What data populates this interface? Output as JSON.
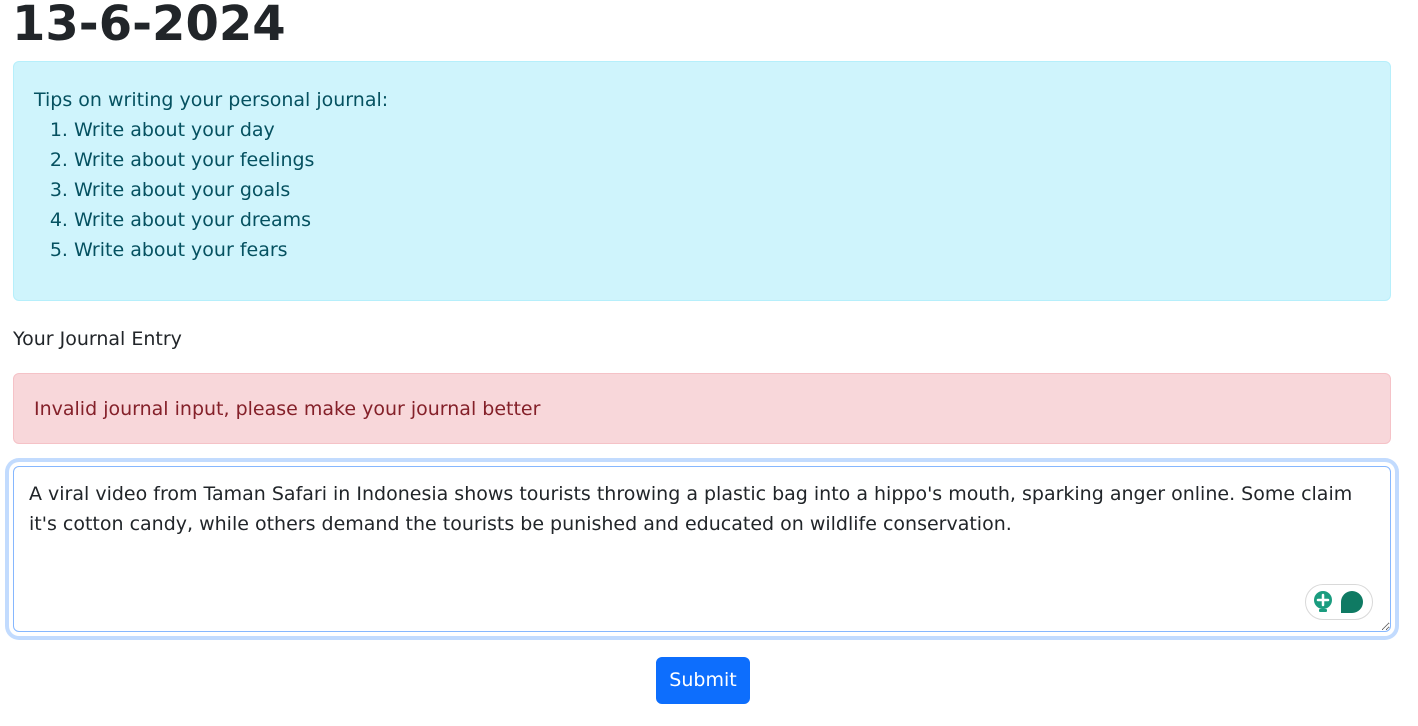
{
  "page_title": "13-6-2024",
  "tips": {
    "heading": "Tips on writing your personal journal:",
    "items": [
      "Write about your day",
      "Write about your feelings",
      "Write about your goals",
      "Write about your dreams",
      "Write about your fears"
    ]
  },
  "entry": {
    "label": "Your Journal Entry",
    "error": "Invalid journal input, please make your journal better",
    "value": "A viral video from Taman Safari in Indonesia shows tourists throwing a plastic bag into a hippo's mouth, sparking anger online. Some claim it's cotton candy, while others demand the tourists be punished and educated on wildlife conservation."
  },
  "widget": {
    "icons": [
      "lightbulb-icon",
      "speech-bubble-icon"
    ],
    "accent_color": "#1a9c7f"
  },
  "submit_label": "Submit",
  "colors": {
    "primary": "#0d6efd",
    "info_bg": "#cff4fc",
    "danger_bg": "#f8d7da"
  }
}
